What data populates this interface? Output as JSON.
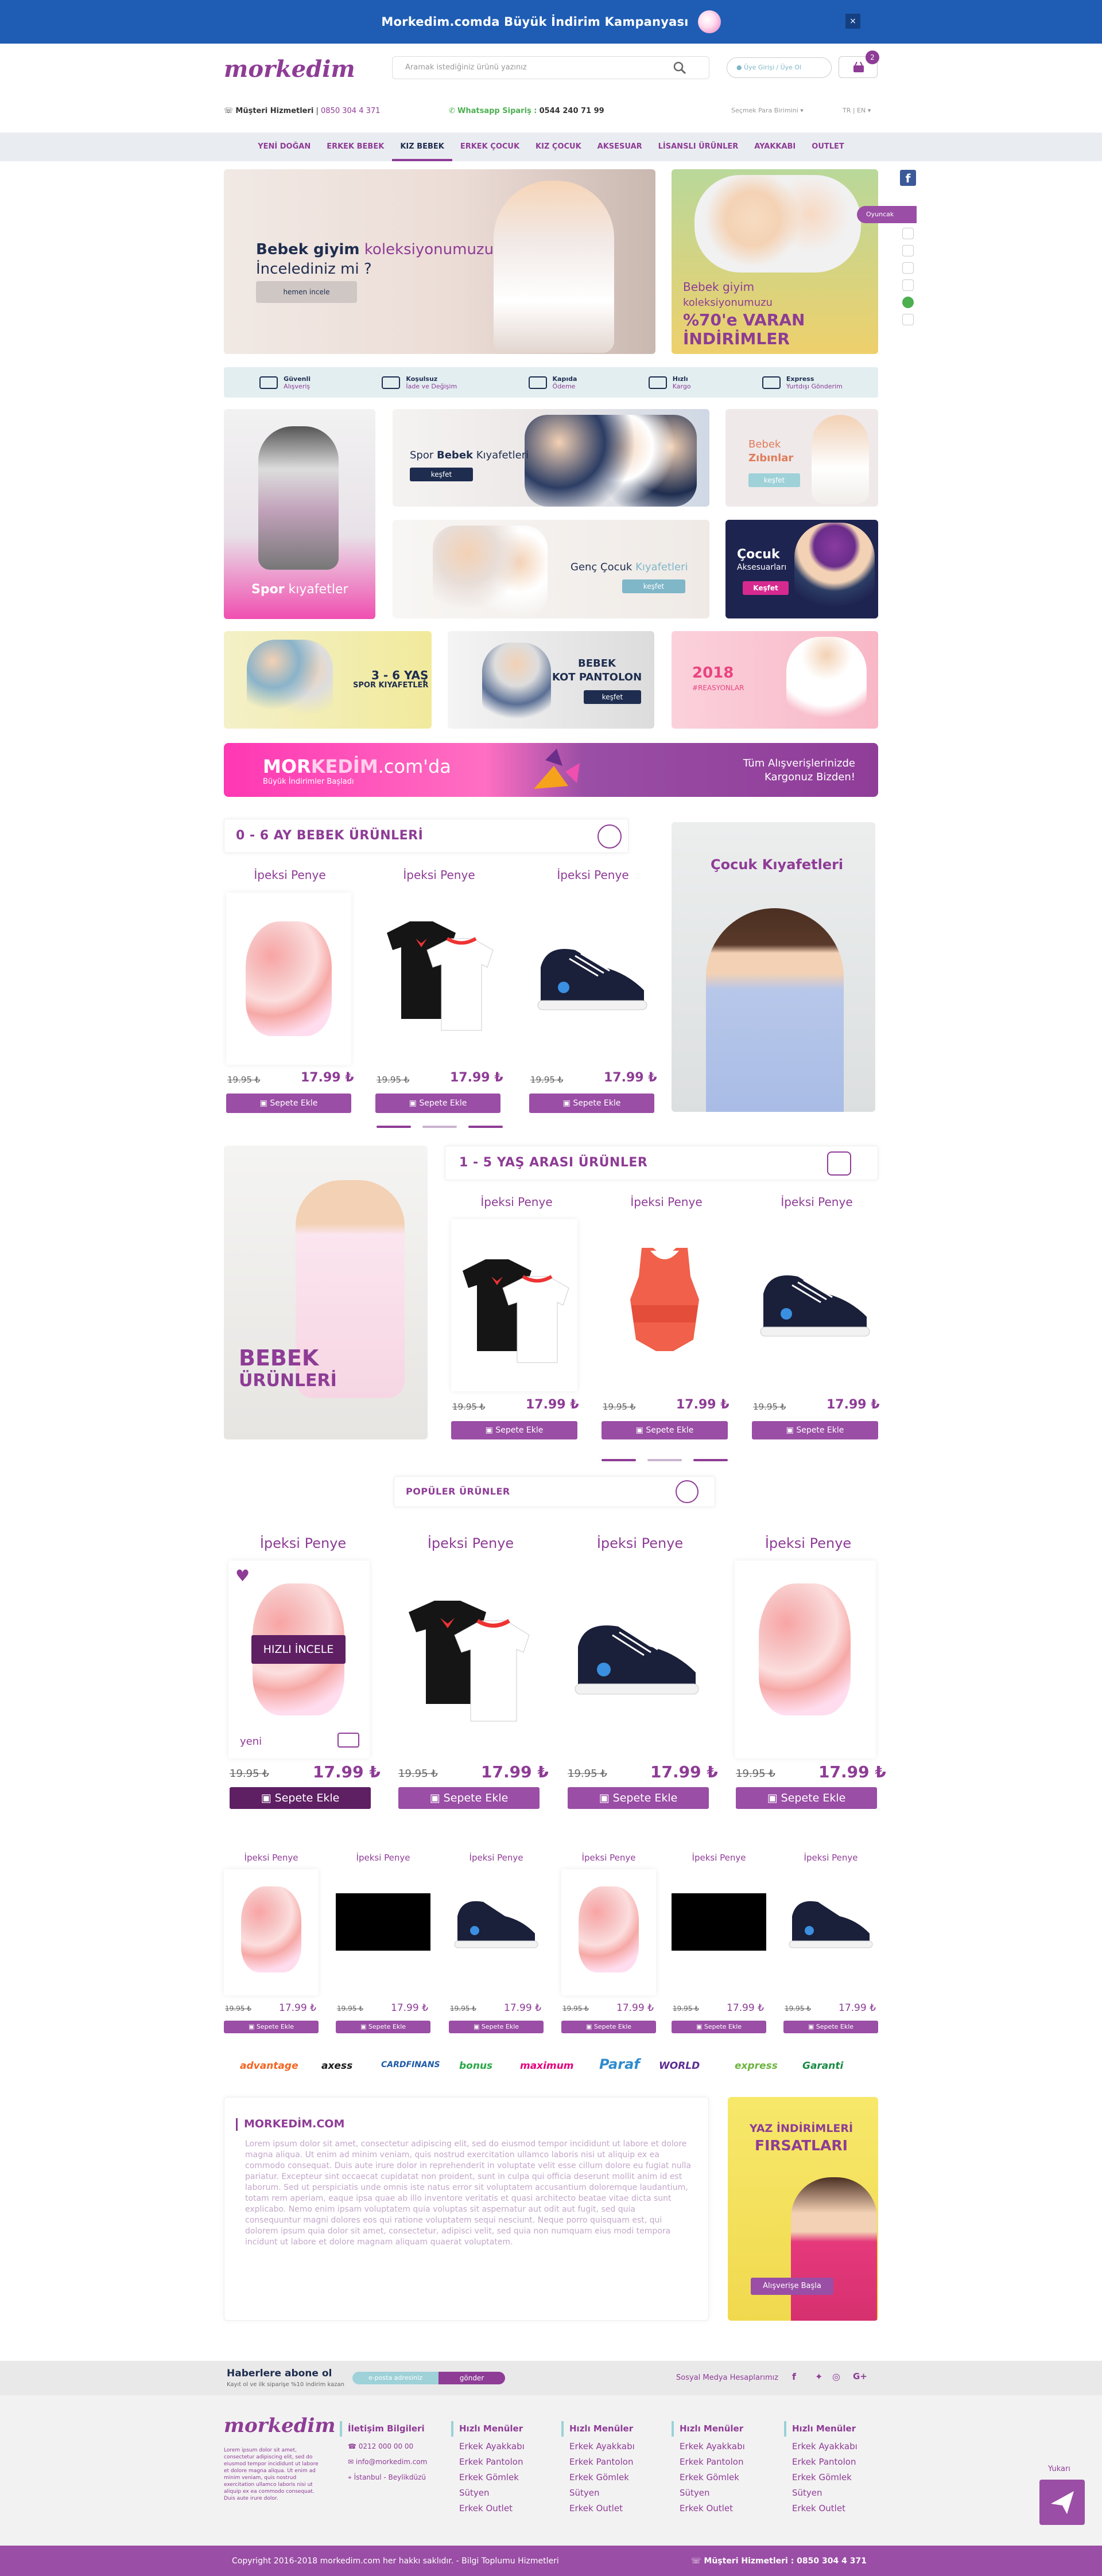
{
  "topbar": {
    "text": "Morkedim.comda Büyük İndirim Kampanyası",
    "close": "×"
  },
  "header": {
    "logo": "morkedim",
    "search_placeholder": "Aramak istediğiniz ürünü yazınız",
    "login": "Üye Girişi / Üye Ol",
    "cart_count": "2",
    "cs_label": "Müşteri Hizmetleri",
    "cs_phone": "0850 304 4 371",
    "wa_label": "Whatsapp Sipariş :",
    "wa_phone": "0544 240 71 99",
    "currency": "Seçmek Para Birimini ▾",
    "lang": "TR | EN ▾"
  },
  "nav": [
    "YENİ DOĞAN",
    "ERKEK BEBEK",
    "KIZ BEBEK",
    "ERKEK ÇOCUK",
    "KIZ ÇOCUK",
    "AKSESUAR",
    "LİSANSLI ÜRÜNLER",
    "AYAKKABI",
    "OUTLET"
  ],
  "hero": {
    "title_a": "Bebek giyim",
    "title_b": " koleksiyonumuzu",
    "title_c": "İncelediniz mi ?",
    "button": "hemen incele",
    "side_a": "Bebek giyim",
    "side_b": "koleksiyonumuzu",
    "side_c": "%70'e VARAN",
    "side_d": "İNDİRİMLER"
  },
  "features": [
    {
      "a": "Güvenli",
      "b": "Alışveriş"
    },
    {
      "a": "Koşulsuz",
      "b": "İade ve Değişim"
    },
    {
      "a": "Kapıda",
      "b": "Ödeme"
    },
    {
      "a": "Hızlı",
      "b": "Kargo"
    },
    {
      "a": "Express",
      "b": "Yurtdışı Gönderim"
    }
  ],
  "tiles": {
    "spor_a": "Spor",
    "spor_b": " kıyafetler",
    "spor_bebek_a": "Spor ",
    "spor_bebek_b": "Bebek",
    "spor_bebek_c": " Kıyafetleri",
    "kesfet": "keşfet",
    "zibin_a": "Bebek",
    "zibin_b": "Zıbınlar",
    "genc_a": "Genç Çocuk ",
    "genc_b": "Kıyafetleri",
    "aks_a": "Çocuk",
    "aks_b": "Aksesuarları",
    "aks_btn": "Keşfet",
    "spor36_a": "3 - 6 YAŞ",
    "spor36_b": "SPOR KIYAFETLER",
    "kot_a": "BEBEK",
    "kot_b": "KOT PANTOLON",
    "kot_btn": "keşfet",
    "y2018_a": "2018",
    "y2018_b": "#REASYONLAR"
  },
  "promo": {
    "a": "MOR",
    "b": "KEDİM",
    "c": ".com'da",
    "sub": "Büyük İndirimler Başladı",
    "r1": "Tüm Alışverişlerinizde",
    "r2": "Kargonuz Bizden!"
  },
  "sec1": {
    "title": "0 - 6  AY BEBEK ÜRÜNLERİ",
    "side": "Çocuk Kıyafetleri"
  },
  "sec2": {
    "title": "1 - 5  YAŞ ARASI ÜRÜNLER",
    "side_a": "BEBEK",
    "side_b": "ÜRÜNLERİ"
  },
  "sec3": {
    "title": "POPÜLER ÜRÜNLER",
    "quick": "HIZLI İNCELE",
    "new": "yeni"
  },
  "product": {
    "name": "İpeksi Penye",
    "old": "19.95 ₺",
    "new": "17.99 ₺",
    "btn": "Sepete Ekle"
  },
  "brands": [
    "advantage",
    "axess",
    "CARDFINANS",
    "bonus",
    "maximum",
    "Paraf",
    "WORLD",
    "express",
    "Garanti"
  ],
  "about": {
    "title": "MORKEDİM.COM",
    "text": "Lorem ipsum dolor sit amet, consectetur adipiscing elit, sed do eiusmod tempor incididunt ut labore et dolore magna aliqua. Ut enim ad minim veniam, quis nostrud exercitation ullamco laboris nisi ut aliquip ex ea commodo consequat. Duis aute irure dolor in reprehenderit in voluptate velit esse cillum dolore eu fugiat nulla pariatur. Excepteur sint occaecat cupidatat non proident, sunt in culpa qui officia deserunt mollit anim id est laborum. Sed ut perspiciatis unde omnis iste natus error sit voluptatem accusantium doloremque laudantium, totam rem aperiam, eaque ipsa quae ab illo inventore veritatis et quasi architecto beatae vitae dicta sunt explicabo. Nemo enim ipsam voluptatem quia voluptas sit aspernatur aut odit aut fugit, sed quia consequuntur magni dolores eos qui ratione voluptatem sequi nesciunt. Neque porro quisquam est, qui dolorem ipsum quia dolor sit amet, consectetur, adipisci velit, sed quia non numquam eius modi tempora incidunt ut labore et dolore magnam aliquam quaerat voluptatem."
  },
  "sale": {
    "title_a": "YAZ İNDİRİMLERİ",
    "title_b": "FIRSATLARI",
    "btn": "Alışverişe Başla"
  },
  "newsletter": {
    "title": "Haberlere abone ol",
    "sub": "Kayıt ol ve ilk siparişe %10 indirim kazan",
    "placeholder": "e-posta adresiniz",
    "btn": "gönder",
    "social": "Sosyal Medya Hesaplarımız"
  },
  "footer": {
    "logo": "morkedim",
    "lorem": "Lorem ipsum dolor sit amet, consectetur adipiscing elit, sed do eiusmod tempor incididunt ut labore et dolore magna aliqua. Ut enim ad minim veniam, quis nostrud exercitation ullamco laboris nisi ut aliquip ex ea commodo consequat. Duis aute irure dolor.",
    "contact_title": "İletişim Bilgileri",
    "phone": "0212 000 00 00",
    "email": "info@morkedim.com",
    "address": "İstanbul - Beylikdüzü",
    "menu_title": "Hızlı Menüler",
    "menu": [
      "Erkek Ayakkabı",
      "Erkek Pantolon",
      "Erkek Gömlek",
      "Sütyen",
      "Erkek Outlet"
    ],
    "copy": "Copyright 2016-2018 morkedim.com her hakkı saklıdır. - Bilgi Toplumu Hizmetleri",
    "cs": "Müşteri Hizmetleri : 0850 304 4 371",
    "up": "Yukarı"
  },
  "side": {
    "toy": "Oyuncak"
  }
}
